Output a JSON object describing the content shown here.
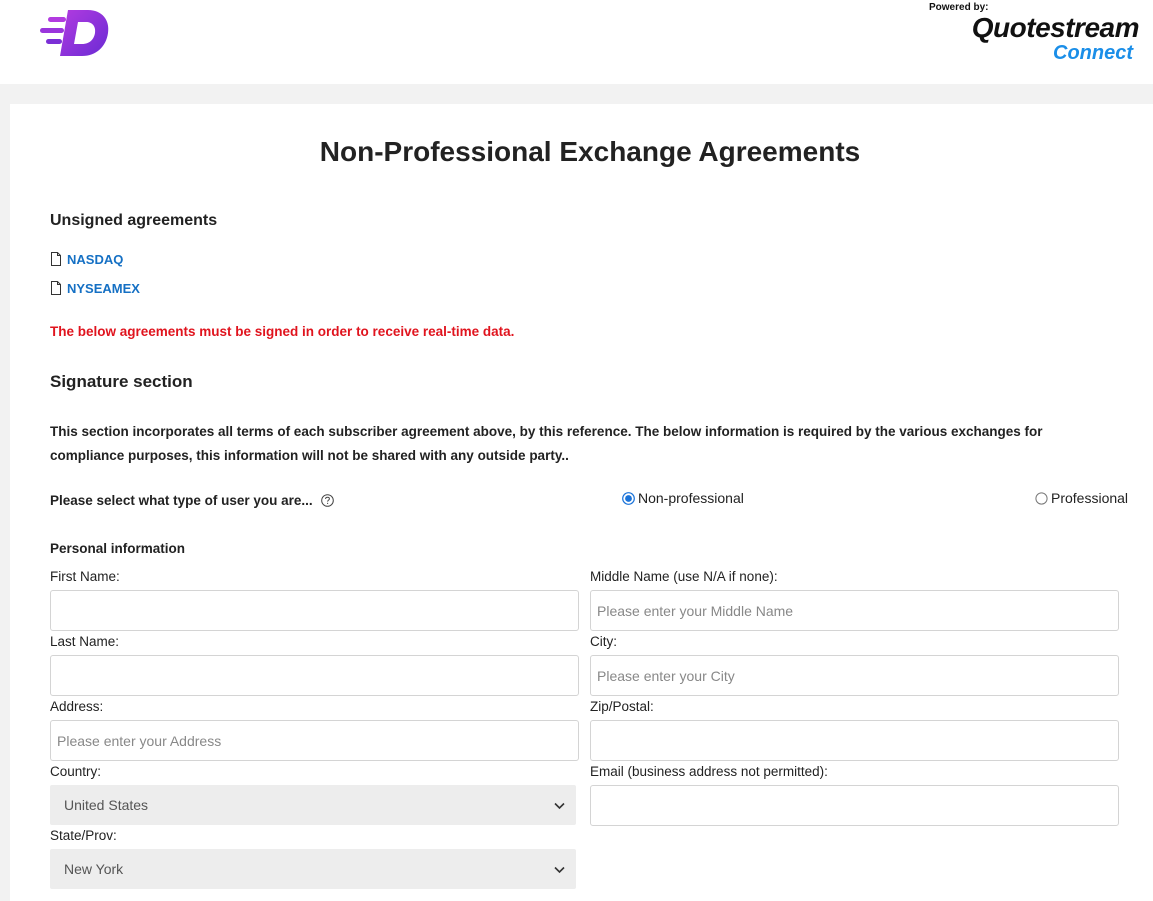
{
  "header": {
    "powered_label": "Powered by:",
    "brand": "Quotestream",
    "brand_sub": "Connect"
  },
  "page": {
    "title": "Non-Professional Exchange Agreements"
  },
  "unsigned": {
    "heading": "Unsigned agreements",
    "items": [
      {
        "label": "NASDAQ"
      },
      {
        "label": "NYSEAMEX"
      }
    ]
  },
  "warning": "The below agreements must be signed in order to receive real-time data.",
  "signature": {
    "heading": "Signature section",
    "intro": "This section incorporates all terms of each subscriber agreement above, by this reference. The below information is required by the various exchanges for compliance purposes, this information will not be shared with any outside party.."
  },
  "user_type": {
    "question": "Please select what type of user you are...",
    "options": [
      {
        "label": "Non-professional",
        "selected": true
      },
      {
        "label": "Professional",
        "selected": false
      }
    ]
  },
  "personal": {
    "heading": "Personal information",
    "first_name": {
      "label": "First Name:",
      "value": "",
      "placeholder": ""
    },
    "middle_name": {
      "label": "Middle Name (use N/A if none):",
      "value": "",
      "placeholder": "Please enter your Middle Name"
    },
    "last_name": {
      "label": "Last Name:",
      "value": "",
      "placeholder": ""
    },
    "city": {
      "label": "City:",
      "value": "",
      "placeholder": "Please enter your City"
    },
    "address": {
      "label": "Address:",
      "value": "",
      "placeholder": "Please enter your Address"
    },
    "zip": {
      "label": "Zip/Postal:",
      "value": "",
      "placeholder": ""
    },
    "country": {
      "label": "Country:",
      "selected": "United States"
    },
    "email": {
      "label": "Email (business address not permitted):",
      "value": "",
      "placeholder": ""
    },
    "state": {
      "label": "State/Prov:",
      "selected": "New York"
    }
  },
  "colors": {
    "link": "#1570c4",
    "warning": "#e0141e",
    "logo_purple": "#7b2fd6",
    "brand_blue": "#1a8ee8",
    "radio_blue": "#1a73d9"
  },
  "icons": {
    "logo": "d-speed-logo",
    "agreement": "document-icon",
    "help": "question-circle-icon",
    "select": "chevron-down-icon"
  }
}
